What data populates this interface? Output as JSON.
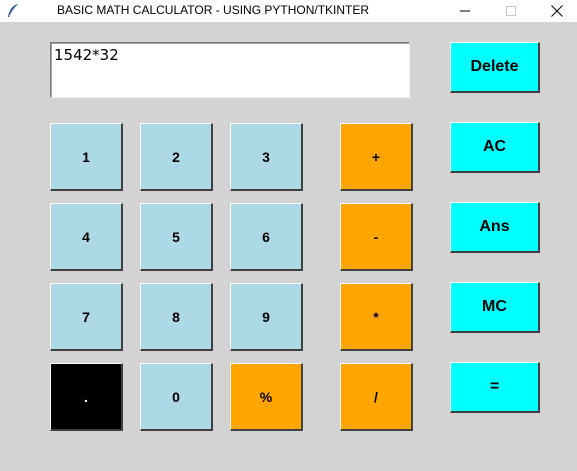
{
  "window": {
    "title": "BASIC MATH CALCULATOR - USING PYTHON/TKINTER",
    "icon": "feather-icon"
  },
  "display": {
    "value": "1542*32"
  },
  "keypad": {
    "one": "1",
    "two": "2",
    "three": "3",
    "four": "4",
    "five": "5",
    "six": "6",
    "seven": "7",
    "eight": "8",
    "nine": "9",
    "zero": "0",
    "dot": ".",
    "percent": "%",
    "plus": "+",
    "minus": "-",
    "multiply": "*",
    "divide": "/"
  },
  "side": {
    "delete": "Delete",
    "ac": "AC",
    "ans": "Ans",
    "mc": "MC",
    "equals": "="
  },
  "colors": {
    "background": "#d3d3d3",
    "number_key": "#add8e6",
    "operator_key": "#ffa500",
    "side_key": "#00ffff",
    "dot_key": "#000000"
  }
}
